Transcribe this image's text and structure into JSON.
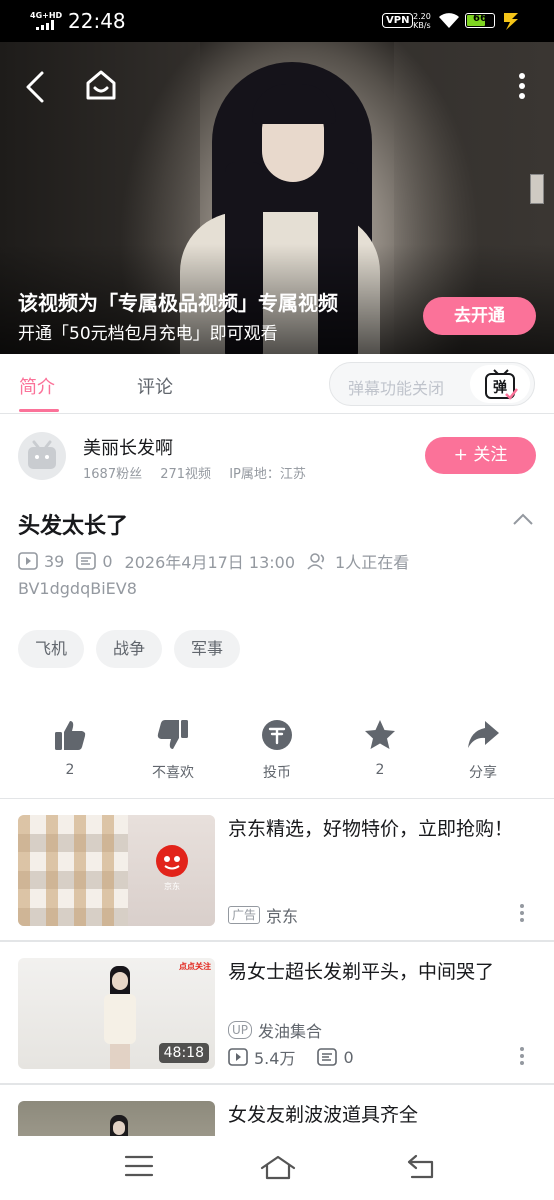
{
  "status_bar": {
    "network": "4G+HD",
    "time": "22:48",
    "vpn": "VPN",
    "speed_value": "2.20",
    "speed_unit": "KB/s",
    "battery": "66"
  },
  "video": {
    "paywall_title": "该视频为「专属极品视频」专属视频",
    "paywall_subtitle": "开通「50元档包月充电」即可观看",
    "open_button": "去开通"
  },
  "tabs": {
    "intro": "简介",
    "comments": "评论",
    "danmaku_placeholder": "弹幕功能关闭",
    "danmaku_icon_text": "弹"
  },
  "uploader": {
    "name": "美丽长发啊",
    "fans": "1687粉丝",
    "videos": "271视频",
    "ip": "IP属地：江苏",
    "follow_button": "+ 关注"
  },
  "info": {
    "title": "头发太长了",
    "plays": "39",
    "danmaku_count": "0",
    "datetime": "2026年4月17日 13:00",
    "watching": "1人正在看",
    "bvid": "BV1dgdqBiEV8",
    "tags": [
      "飞机",
      "战争",
      "军事"
    ]
  },
  "actions": {
    "like": "2",
    "dislike": "不喜欢",
    "coin": "投币",
    "favorite": "2",
    "share": "分享"
  },
  "recommendations": [
    {
      "title": "京东精选，好物特价，立即抢购！",
      "ad_badge": "广告",
      "source": "京东",
      "thumb_logo_text": "京东"
    },
    {
      "title": "易女士超长发剃平头，中间哭了",
      "up_badge": "UP",
      "author": "发油集合",
      "duration": "48:18",
      "plays": "5.4万",
      "danmaku": "0",
      "thumb_corner_text": "点点关注"
    },
    {
      "title": "女发友剃波波道具齐全"
    }
  ],
  "colors": {
    "accent": "#fb7299",
    "text_primary": "#18191c",
    "text_secondary": "#9499a0"
  }
}
